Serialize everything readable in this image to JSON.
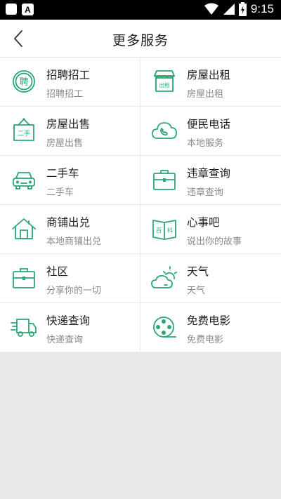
{
  "status_bar": {
    "time": "9:15"
  },
  "header": {
    "title": "更多服务"
  },
  "services": [
    {
      "title": "招聘招工",
      "subtitle": "招聘招工",
      "icon": "recruit-icon",
      "badge": "聘"
    },
    {
      "title": "房屋出租",
      "subtitle": "房屋出租",
      "icon": "house-rent-icon",
      "badge": "出租"
    },
    {
      "title": "房屋出售",
      "subtitle": "房屋出售",
      "icon": "house-sale-icon",
      "badge": "二手"
    },
    {
      "title": "便民电话",
      "subtitle": "本地服务",
      "icon": "phone-cloud-icon"
    },
    {
      "title": "二手车",
      "subtitle": "二手车",
      "icon": "car-icon"
    },
    {
      "title": "违章查询",
      "subtitle": "违章查询",
      "icon": "briefcase-icon"
    },
    {
      "title": "商铺出兑",
      "subtitle": "本地商铺出兑",
      "icon": "shop-house-icon"
    },
    {
      "title": "心事吧",
      "subtitle": "说出你的故事",
      "icon": "book-icon",
      "badge_left": "百",
      "badge_right": "科"
    },
    {
      "title": "社区",
      "subtitle": "分享你的一切",
      "icon": "community-bag-icon"
    },
    {
      "title": "天气",
      "subtitle": "天气",
      "icon": "weather-icon"
    },
    {
      "title": "快递查询",
      "subtitle": "快递查询",
      "icon": "delivery-truck-icon"
    },
    {
      "title": "免费电影",
      "subtitle": "免费电影",
      "icon": "film-reel-icon"
    }
  ],
  "colors": {
    "accent": "#2aa873",
    "background": "#e8e8e8",
    "status_bar": "#000000"
  }
}
